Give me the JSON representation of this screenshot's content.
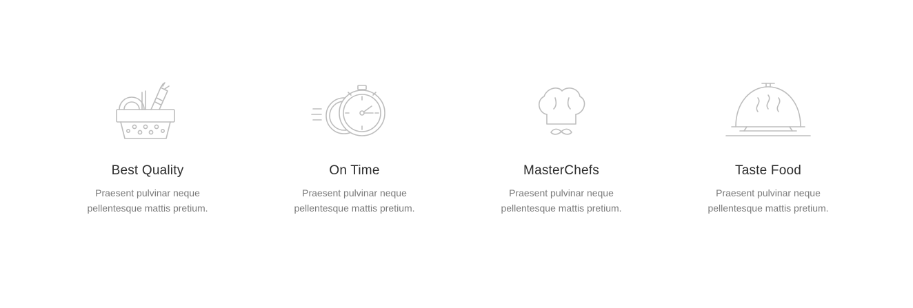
{
  "features": [
    {
      "icon": "basket-icon",
      "title": "Best Quality",
      "description": "Praesent pulvinar neque pellentesque mattis pretium."
    },
    {
      "icon": "stopwatch-icon",
      "title": "On Time",
      "description": "Praesent pulvinar neque pellentesque mattis pretium."
    },
    {
      "icon": "chef-hat-icon",
      "title": "MasterChefs",
      "description": "Praesent pulvinar neque pellentesque mattis pretium."
    },
    {
      "icon": "cloche-icon",
      "title": "Taste Food",
      "description": "Praesent pulvinar neque pellentesque mattis pretium."
    }
  ],
  "colors": {
    "icon_stroke": "#bdbdbd",
    "title": "#2b2b2b",
    "description": "#7a7a7a"
  }
}
